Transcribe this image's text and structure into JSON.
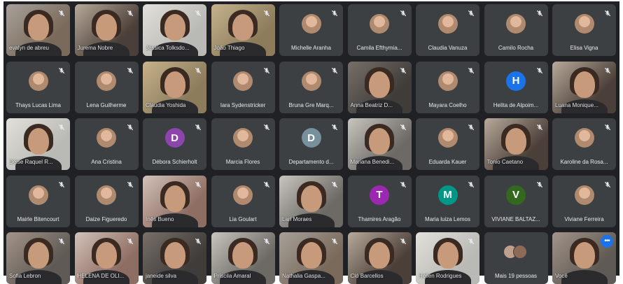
{
  "meeting": {
    "participants": [
      {
        "name": "evalyn de abreu",
        "type": "video",
        "col": 0,
        "row": 0
      },
      {
        "name": "Jurema Nobre",
        "type": "video",
        "col": 1,
        "row": 0
      },
      {
        "name": "Jéssica Tolksdo...",
        "type": "video",
        "col": 2,
        "row": 0
      },
      {
        "name": "João Thiago",
        "type": "video",
        "col": 3,
        "row": 0
      },
      {
        "name": "Michelle Aranha",
        "type": "photo",
        "col": 4,
        "row": 0
      },
      {
        "name": "Camila Efthymia...",
        "type": "photo",
        "col": 5,
        "row": 0
      },
      {
        "name": "Claudia Vanuza",
        "type": "photo",
        "col": 6,
        "row": 0
      },
      {
        "name": "Camilo Rocha",
        "type": "photo",
        "col": 7,
        "row": 0
      },
      {
        "name": "Elisa Vigna",
        "type": "photo",
        "col": 8,
        "row": 0
      },
      {
        "name": "Thays Lucas Lima",
        "type": "photo",
        "col": 0,
        "row": 1
      },
      {
        "name": "Lena Guilherme",
        "type": "photo",
        "col": 1,
        "row": 1
      },
      {
        "name": "Claudia Yoshida",
        "type": "video",
        "col": 2,
        "row": 1
      },
      {
        "name": "Iara Sydenstricker",
        "type": "photo",
        "col": 3,
        "row": 1
      },
      {
        "name": "Bruna Gre Marq...",
        "type": "photo",
        "col": 4,
        "row": 1
      },
      {
        "name": "Anna Beatriz D...",
        "type": "video",
        "col": 5,
        "row": 1
      },
      {
        "name": "Mayara Coelho",
        "type": "photo",
        "col": 6,
        "row": 1
      },
      {
        "name": "Helita de Alpoim...",
        "type": "letter",
        "letter": "H",
        "color": "#1a73e8",
        "col": 7,
        "row": 1
      },
      {
        "name": "Luana Monique...",
        "type": "video",
        "col": 8,
        "row": 1
      },
      {
        "name": "Deise Raquel R...",
        "type": "video",
        "col": 0,
        "row": 2
      },
      {
        "name": "Ana Cristina",
        "type": "photo",
        "col": 1,
        "row": 2
      },
      {
        "name": "Débora Schierholt",
        "type": "letter",
        "letter": "D",
        "color": "#8e44ad",
        "col": 2,
        "row": 2
      },
      {
        "name": "Marcia Flores",
        "type": "photo",
        "col": 3,
        "row": 2
      },
      {
        "name": "Departamento d...",
        "type": "letter",
        "letter": "D",
        "color": "#78909c",
        "col": 4,
        "row": 2
      },
      {
        "name": "Mariana Benedi...",
        "type": "video",
        "col": 5,
        "row": 2
      },
      {
        "name": "Eduarda Kauer",
        "type": "photo",
        "col": 6,
        "row": 2
      },
      {
        "name": "Tonio Caetano",
        "type": "video",
        "col": 7,
        "row": 2
      },
      {
        "name": "Karoline da Rosa...",
        "type": "photo",
        "col": 8,
        "row": 2
      },
      {
        "name": "Mairle Bitencourt",
        "type": "photo",
        "col": 0,
        "row": 3
      },
      {
        "name": "Daize Figueredo",
        "type": "photo",
        "col": 1,
        "row": 3
      },
      {
        "name": "Inês Bueno",
        "type": "video",
        "col": 2,
        "row": 3
      },
      {
        "name": "Lia Goulart",
        "type": "photo",
        "col": 3,
        "row": 3
      },
      {
        "name": "Lari Moraes",
        "type": "video",
        "col": 4,
        "row": 3
      },
      {
        "name": "Thamires Aragão",
        "type": "letter",
        "letter": "T",
        "color": "#9c27b0",
        "col": 5,
        "row": 3
      },
      {
        "name": "Maria luiza Lemos",
        "type": "letter",
        "letter": "M",
        "color": "#009688",
        "col": 6,
        "row": 3
      },
      {
        "name": "VIVIANE BALTAZ...",
        "type": "letter",
        "letter": "V",
        "color": "#33691e",
        "col": 7,
        "row": 3
      },
      {
        "name": "Viviane Ferreira",
        "type": "photo",
        "col": 8,
        "row": 3
      },
      {
        "name": "Sofia Lebron",
        "type": "video",
        "col": 0,
        "row": 4
      },
      {
        "name": "HELENA DE OLI...",
        "type": "video",
        "col": 1,
        "row": 4
      },
      {
        "name": "janeide silva",
        "type": "video",
        "col": 2,
        "row": 4
      },
      {
        "name": "Priscila Amaral",
        "type": "video",
        "col": 3,
        "row": 4
      },
      {
        "name": "Nathalia Gaspa...",
        "type": "video",
        "col": 4,
        "row": 4
      },
      {
        "name": "Cló Barcellos",
        "type": "video",
        "col": 5,
        "row": 4
      },
      {
        "name": "Hellen Rodrigues",
        "type": "video",
        "col": 6,
        "row": 4
      },
      {
        "name": "Mais 19 pessoas",
        "type": "more",
        "col": 7,
        "row": 4
      },
      {
        "name": "Você",
        "type": "video",
        "self": true,
        "col": 8,
        "row": 4
      }
    ],
    "icons": {
      "mic": "mic-off-icon",
      "menu": "more-options-icon"
    },
    "colors": {
      "background": "#202124",
      "tile": "#3c4043",
      "accent": "#1a73e8"
    }
  }
}
